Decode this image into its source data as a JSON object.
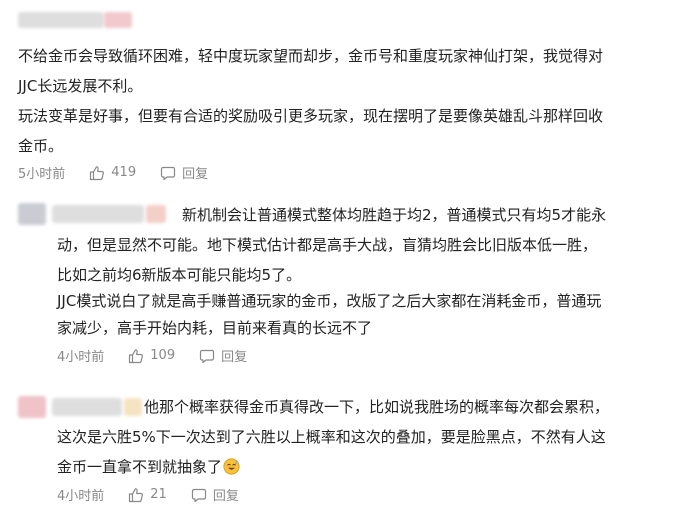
{
  "comments": [
    {
      "lines": [
        "不给金币会导致循环困难，轻中度玩家望而却步，金币号和重度玩家神仙打架，我觉得对",
        "JJC长远发展不利。",
        "玩法变革是好事，但要有合适的奖励吸引更多玩家，现在摆明了是要像英雄乱斗那样回收",
        "金币。"
      ],
      "time": "5小时前",
      "likes": "419",
      "reply": "回复"
    },
    {
      "lines": [
        "新机制会让普通模式整体均胜趋于均2，普通模式只有均5才能永",
        "动，但是显然不可能。地下模式估计都是高手大战，盲猜均胜会比旧版本低一胜，",
        "比如之前均6新版本可能只能均5了。",
        "JJC模式说白了就是高手赚普通玩家的金币，改版了之后大家都在消耗金币，普通玩",
        "家减少，高手开始内耗，目前来看真的长远不了"
      ],
      "time": "4小时前",
      "likes": "109",
      "reply": "回复"
    },
    {
      "lines": [
        "他那个概率获得金币真得改一下，比如说我胜场的概率每次都会累积，",
        "这次是六胜5%下一次达到了六胜以上概率和这次的叠加，要是脸黑点，不然有人这",
        "金币一直拿不到就抽象了"
      ],
      "emoji": "sweat-smile-emoji",
      "time": "4小时前",
      "likes": "21",
      "reply": "回复"
    }
  ]
}
